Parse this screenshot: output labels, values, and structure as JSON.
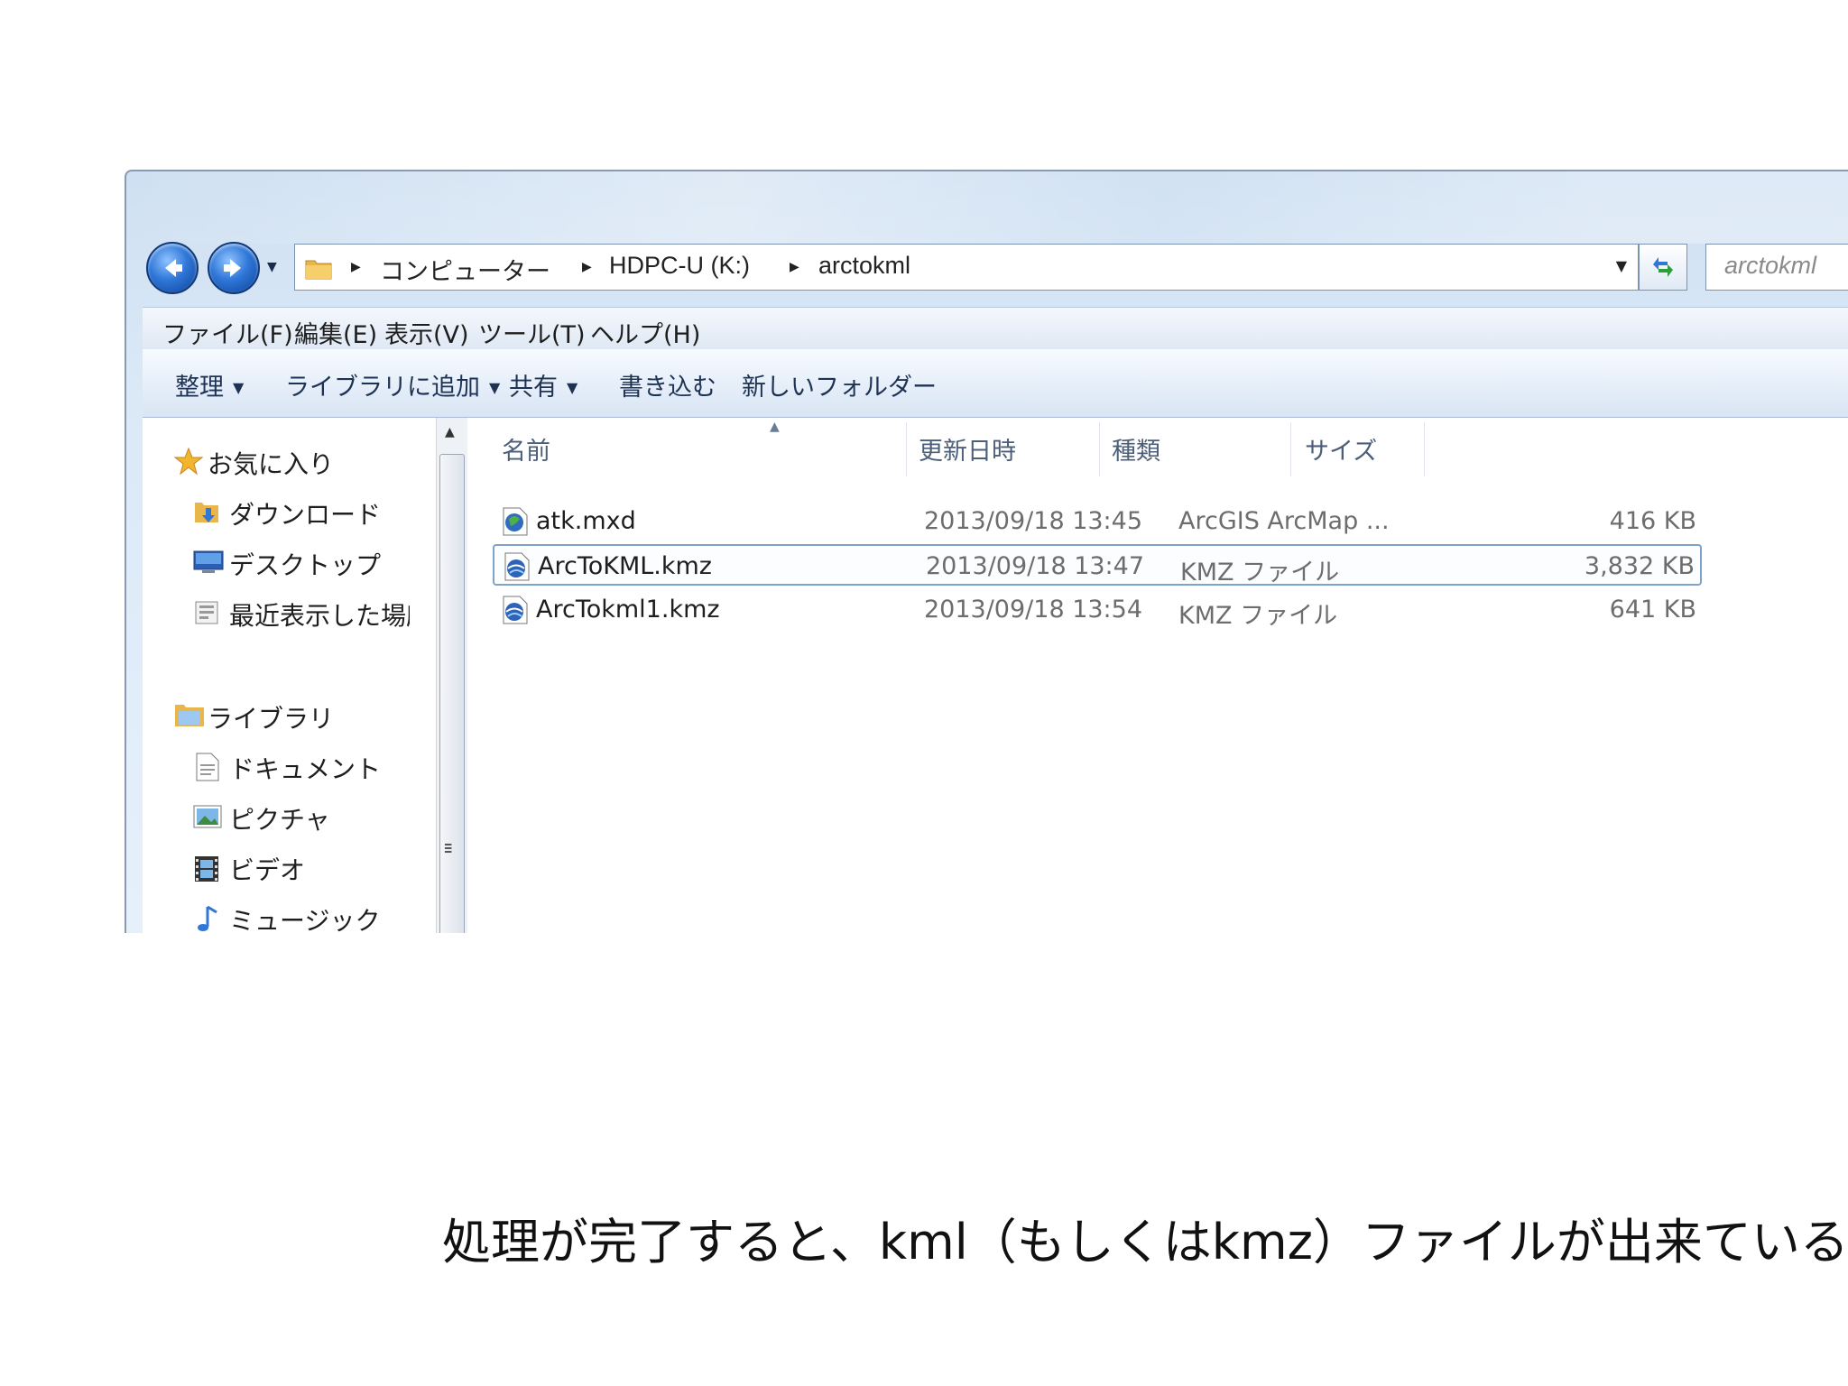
{
  "window": {
    "address": {
      "crumbs": [
        "コンピューター",
        "HDPC-U (K:)",
        "arctokml"
      ]
    },
    "search_placeholder": "arctokml"
  },
  "menubar": {
    "items": [
      "ファイル(F)",
      "編集(E)",
      "表示(V)",
      "ツール(T)",
      "ヘルプ(H)"
    ]
  },
  "toolbar": {
    "organize": "整理",
    "add_to_library": "ライブラリに追加",
    "share": "共有",
    "burn": "書き込む",
    "new_folder": "新しいフォルダー"
  },
  "navpane": {
    "favorites": {
      "label": "お気に入り",
      "items": [
        "ダウンロード",
        "デスクトップ",
        "最近表示した場所"
      ]
    },
    "libraries": {
      "label": "ライブラリ",
      "items": [
        "ドキュメント",
        "ピクチャ",
        "ビデオ",
        "ミュージック"
      ]
    }
  },
  "columns": {
    "name": "名前",
    "date": "更新日時",
    "type": "種類",
    "size": "サイズ"
  },
  "files": [
    {
      "name": "atk.mxd",
      "date": "2013/09/18 13:45",
      "type": "ArcGIS ArcMap ...",
      "size": "416 KB",
      "icon": "arcmap-document-icon"
    },
    {
      "name": "ArcToKML.kmz",
      "date": "2013/09/18 13:47",
      "type": "KMZ ファイル",
      "size": "3,832 KB",
      "icon": "kmz-file-icon",
      "selected": true
    },
    {
      "name": "ArcTokml1.kmz",
      "date": "2013/09/18 13:54",
      "type": "KMZ ファイル",
      "size": "641 KB",
      "icon": "kmz-file-icon"
    }
  ],
  "caption": "処理が完了すると、kml（もしくはkmz）ファイルが出来ている",
  "colors": {
    "selection_border": "#7da2ce",
    "nav_button": "#2f77d8",
    "header_text": "#4d5f78"
  }
}
